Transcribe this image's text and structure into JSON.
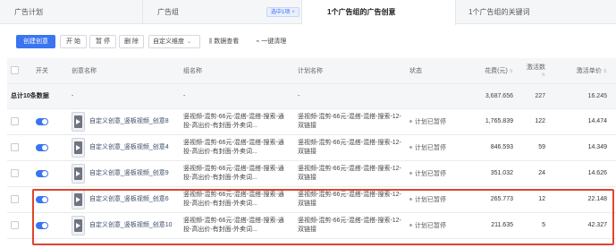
{
  "tabs": [
    {
      "label": "广告计划"
    },
    {
      "label": "广告组",
      "chip": "选中1项",
      "chip_close": "×"
    },
    {
      "label": "1个广告组的广告创意"
    },
    {
      "label": "1个广告组的关键词"
    }
  ],
  "toolbar": {
    "create_label": "创建创意",
    "start_label": "开 始",
    "pause_label": "暂 停",
    "delete_label": "删 除",
    "custom_dim_label": "自定义维度",
    "custom_dim_caret": "⌄",
    "data_view_label": "数据查看",
    "data_view_icon": "bar-chart-icon",
    "clean_label": "一键清理",
    "clean_icon": "broom-icon"
  },
  "table": {
    "headers": {
      "switch": "开关",
      "creative": "创意名称",
      "group": "组名称",
      "plan": "计划名称",
      "status": "状态",
      "spend": "花费(元)",
      "activations": "激活数",
      "unit_price": "激活单价"
    },
    "total": {
      "label": "总计10条数据",
      "creative": "-",
      "group": "-",
      "plan": "-",
      "spend": "3,687.656",
      "activations": "227",
      "unit_price": "16.245"
    },
    "rows": [
      {
        "creative": "自定义创意_竖板视频_创意8",
        "group": "竖视频-混剪-66元-混搭-混搭-搜索-通投-高出价-有封面-外卖词...",
        "plan": "竖视频-混剪-66元-混搭-混搭-搜索-12-双链接",
        "status": "计划已暂停",
        "spend": "1,765.839",
        "activations": "122",
        "unit_price": "14.474"
      },
      {
        "creative": "自定义创意_竖板视频_创意4",
        "group": "竖视频-混剪-66元-混搭-混搭-搜索-通投-高出价-有封面-外卖词...",
        "plan": "竖视频-混剪-66元-混搭-混搭-搜索-12-双链接",
        "status": "计划已暂停",
        "spend": "846.593",
        "activations": "59",
        "unit_price": "14.349"
      },
      {
        "creative": "自定义创意_竖板视频_创意9",
        "group": "竖视频-混剪-66元-混搭-混搭-搜索-通投-高出价-有封面-外卖词...",
        "plan": "竖视频-混剪-66元-混搭-混搭-搜索-12-双链接",
        "status": "计划已暂停",
        "spend": "351.032",
        "activations": "24",
        "unit_price": "14.626"
      },
      {
        "creative": "自定义创意_竖板视频_创意6",
        "group": "竖视频-混剪-66元-混搭-混搭-搜索-通投-高出价-有封面-外卖词...",
        "plan": "竖视频-混剪-66元-混搭-混搭-搜索-12-双链接",
        "status": "计划已暂停",
        "spend": "265.773",
        "activations": "12",
        "unit_price": "22.148"
      },
      {
        "creative": "自定义创意_竖板视频_创意10",
        "group": "竖视频-混剪-66元-混搭-混搭-搜索-通投-高出价-有封面-外卖词...",
        "plan": "竖视频-混剪-66元-混搭-混搭-搜索-12-双链接",
        "status": "计划已暂停",
        "spend": "211.635",
        "activations": "5",
        "unit_price": "42.327"
      }
    ]
  },
  "colors": {
    "accent": "#3a74f0",
    "highlight": "#e0442f"
  }
}
